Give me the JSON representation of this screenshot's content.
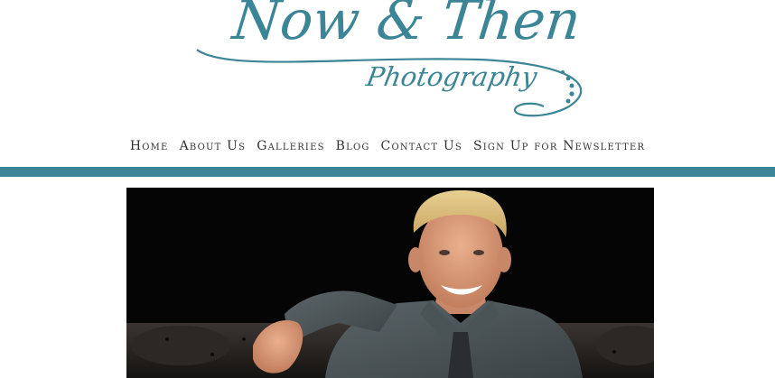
{
  "logo": {
    "title": "Now & Then",
    "subtitle": "Photography",
    "color": "#3b8596"
  },
  "nav": {
    "items": [
      {
        "label": "Home"
      },
      {
        "label": "About Us"
      },
      {
        "label": "Galleries"
      },
      {
        "label": "Blog"
      },
      {
        "label": "Contact Us"
      },
      {
        "label": "Sign Up for Newsletter"
      }
    ]
  },
  "accent_color": "#3b8596",
  "hero": {
    "description": "senior-portrait-photo"
  }
}
